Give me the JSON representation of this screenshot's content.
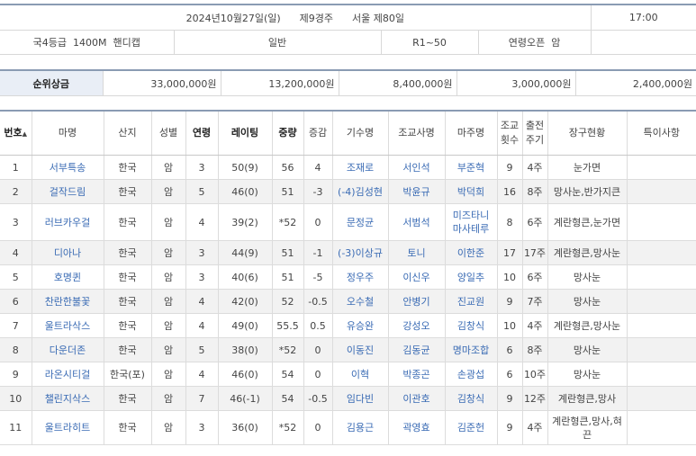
{
  "race_info": {
    "date_round": "2024년10월27일(일)      제9경주      서울 제80일",
    "start_time": "17:00",
    "grade_distance": "국4등급  1400M  핸디캡",
    "race_type": "일반",
    "rating_range": "R1~50",
    "age_sex": "연령오픈  암"
  },
  "prize": {
    "label": "순위상금",
    "values": [
      "33,000,000원",
      "13,200,000원",
      "8,400,000원",
      "3,000,000원",
      "2,400,000원"
    ]
  },
  "columns": [
    "번호",
    "마명",
    "산지",
    "성별",
    "연령",
    "레이팅",
    "중량",
    "증감",
    "기수명",
    "조교사명",
    "마주명",
    "조교\n횟수",
    "출전\n주기",
    "장구현황",
    "특이사항"
  ],
  "sort_glyph": "▲",
  "entries": [
    {
      "no": "1",
      "horse": "서부특송",
      "origin": "한국",
      "sex": "암",
      "age": "3",
      "rating": "50(9)",
      "weight": "56",
      "change": "4",
      "jockey": "조재로",
      "trainer": "서인석",
      "owner": "부준혁",
      "train_cnt": "9",
      "cycle": "4주",
      "gear": "눈가면",
      "note": ""
    },
    {
      "no": "2",
      "horse": "걸작드림",
      "origin": "한국",
      "sex": "암",
      "age": "5",
      "rating": "46(0)",
      "weight": "51",
      "change": "-3",
      "jockey": "(-4)김성현",
      "trainer": "박윤규",
      "owner": "박덕희",
      "train_cnt": "16",
      "cycle": "8주",
      "gear": "망사눈,반가지큰",
      "note": ""
    },
    {
      "no": "3",
      "horse": "러브카우걸",
      "origin": "한국",
      "sex": "암",
      "age": "4",
      "rating": "39(2)",
      "weight": "*52",
      "change": "0",
      "jockey": "문정균",
      "trainer": "서범석",
      "owner": "미즈타니\n마사테루",
      "train_cnt": "8",
      "cycle": "6주",
      "gear": "계란형큰,눈가면",
      "note": ""
    },
    {
      "no": "4",
      "horse": "디아나",
      "origin": "한국",
      "sex": "암",
      "age": "3",
      "rating": "44(9)",
      "weight": "51",
      "change": "-1",
      "jockey": "(-3)이상규",
      "trainer": "토니",
      "owner": "이한준",
      "train_cnt": "17",
      "cycle": "17주",
      "gear": "계란형큰,망사눈",
      "note": ""
    },
    {
      "no": "5",
      "horse": "호명퀸",
      "origin": "한국",
      "sex": "암",
      "age": "3",
      "rating": "40(6)",
      "weight": "51",
      "change": "-5",
      "jockey": "정우주",
      "trainer": "이신우",
      "owner": "양일추",
      "train_cnt": "10",
      "cycle": "6주",
      "gear": "망사눈",
      "note": ""
    },
    {
      "no": "6",
      "horse": "찬란한불꽃",
      "origin": "한국",
      "sex": "암",
      "age": "4",
      "rating": "42(0)",
      "weight": "52",
      "change": "-0.5",
      "jockey": "오수철",
      "trainer": "안병기",
      "owner": "진교원",
      "train_cnt": "9",
      "cycle": "7주",
      "gear": "망사눈",
      "note": ""
    },
    {
      "no": "7",
      "horse": "울트라삭스",
      "origin": "한국",
      "sex": "암",
      "age": "4",
      "rating": "49(0)",
      "weight": "55.5",
      "change": "0.5",
      "jockey": "유승완",
      "trainer": "강성오",
      "owner": "김창식",
      "train_cnt": "10",
      "cycle": "4주",
      "gear": "계란형큰,망사눈",
      "note": ""
    },
    {
      "no": "8",
      "horse": "다운더존",
      "origin": "한국",
      "sex": "암",
      "age": "5",
      "rating": "38(0)",
      "weight": "*52",
      "change": "0",
      "jockey": "이동진",
      "trainer": "김동균",
      "owner": "명마조합",
      "train_cnt": "6",
      "cycle": "8주",
      "gear": "망사눈",
      "note": ""
    },
    {
      "no": "9",
      "horse": "라온시티걸",
      "origin": "한국(포)",
      "sex": "암",
      "age": "4",
      "rating": "46(0)",
      "weight": "54",
      "change": "0",
      "jockey": "이혁",
      "trainer": "박종곤",
      "owner": "손광섭",
      "train_cnt": "6",
      "cycle": "10주",
      "gear": "망사눈",
      "note": ""
    },
    {
      "no": "10",
      "horse": "챌린지삭스",
      "origin": "한국",
      "sex": "암",
      "age": "7",
      "rating": "46(-1)",
      "weight": "54",
      "change": "-0.5",
      "jockey": "임다빈",
      "trainer": "이관호",
      "owner": "김창식",
      "train_cnt": "9",
      "cycle": "12주",
      "gear": "계란형큰,망사",
      "note": ""
    },
    {
      "no": "11",
      "horse": "울트라히트",
      "origin": "한국",
      "sex": "암",
      "age": "3",
      "rating": "36(0)",
      "weight": "*52",
      "change": "0",
      "jockey": "김용근",
      "trainer": "곽영효",
      "owner": "김준헌",
      "train_cnt": "9",
      "cycle": "4주",
      "gear": "계란형큰,망사,혀\n끈",
      "note": ""
    }
  ]
}
